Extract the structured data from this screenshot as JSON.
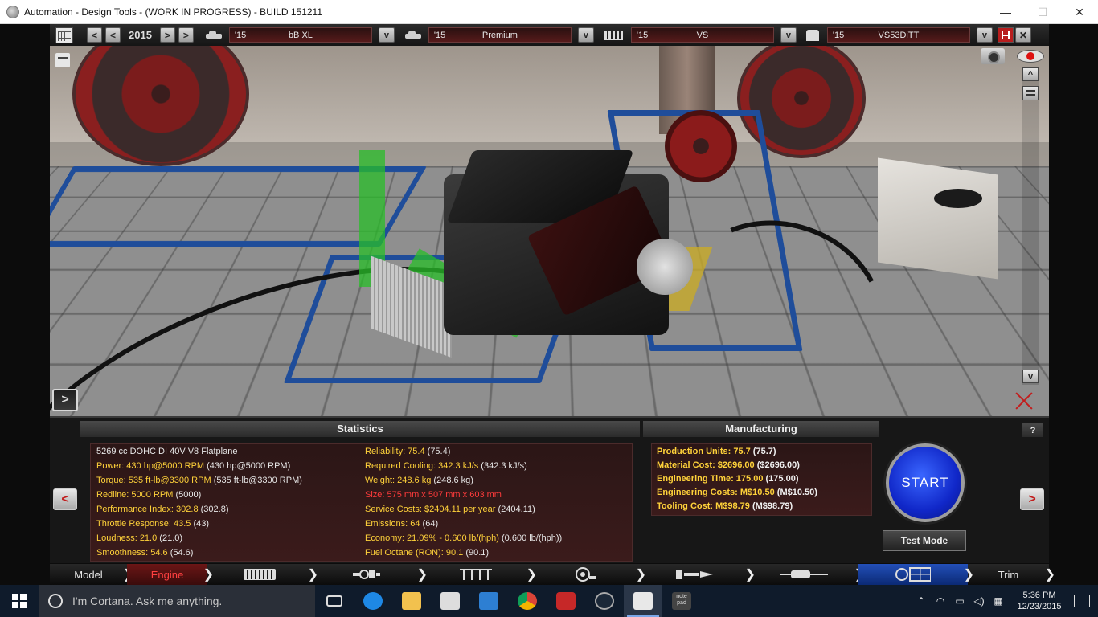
{
  "window": {
    "title": "Automation - Design Tools - (WORK IN PROGRESS) - BUILD 151211",
    "minimize": "—",
    "maximize": "☐",
    "close": "✕"
  },
  "toolbar": {
    "year": "2015",
    "prev2": "<",
    "prev1": "<",
    "next1": ">",
    "next2": ">",
    "model": {
      "year": "'15",
      "name": "bB XL"
    },
    "trim": {
      "year": "'15",
      "name": "Premium"
    },
    "engine": {
      "year": "'15",
      "name": "VS"
    },
    "variant": {
      "year": "'15",
      "name": "VS53DiTT"
    },
    "dropdown": "v",
    "close": "✕"
  },
  "viewport": {
    "expand_label": ">",
    "scroll_up": "^",
    "scroll_down": "v"
  },
  "statistics": {
    "title": "Statistics",
    "left": [
      {
        "label": "5269 cc DOHC DI 40V V8 Flatplane",
        "value": "",
        "style": "plain"
      },
      {
        "label": "Power: 430 hp@5000 RPM",
        "value": " (430 hp@5000 RPM)",
        "style": "yellow"
      },
      {
        "label": "Torque: 535 ft-lb@3300 RPM",
        "value": " (535 ft-lb@3300 RPM)",
        "style": "yellow"
      },
      {
        "label": "Redline: 5000 RPM",
        "value": " (5000)",
        "style": "yellow"
      },
      {
        "label": "Performance Index: 302.8",
        "value": " (302.8)",
        "style": "yellow"
      },
      {
        "label": "Throttle Response: 43.5",
        "value": " (43)",
        "style": "yellow"
      },
      {
        "label": "Loudness: 21.0",
        "value": " (21.0)",
        "style": "yellow"
      },
      {
        "label": "Smoothness: 54.6",
        "value": " (54.6)",
        "style": "yellow"
      }
    ],
    "right": [
      {
        "label": "Reliability: 75.4",
        "value": " (75.4)",
        "style": "yellow"
      },
      {
        "label": "Required Cooling: 342.3 kJ/s",
        "value": " (342.3 kJ/s)",
        "style": "yellow"
      },
      {
        "label": "Weight: 248.6 kg",
        "value": " (248.6 kg)",
        "style": "yellow"
      },
      {
        "label": "Size: 575 mm x 507 mm x 603 mm",
        "value": "",
        "style": "red"
      },
      {
        "label": "Service Costs: $2404.11 per year",
        "value": " (2404.11)",
        "style": "yellow"
      },
      {
        "label": "Emissions: 64",
        "value": " (64)",
        "style": "yellow"
      },
      {
        "label": "Economy: 21.09% - 0.600 lb/(hph)",
        "value": " (0.600 lb/(hph))",
        "style": "yellow"
      },
      {
        "label": "Fuel Octane (RON): 90.1",
        "value": " (90.1)",
        "style": "yellow"
      }
    ]
  },
  "manufacturing": {
    "title": "Manufacturing",
    "rows": [
      {
        "label": "Production Units: 75.7",
        "value": " (75.7)"
      },
      {
        "label": "Material Cost: $2696.00",
        "value": " ($2696.00)"
      },
      {
        "label": "Engineering Time: 175.00",
        "value": " (175.00)"
      },
      {
        "label": "Engineering Costs: M$10.50",
        "value": " (M$10.50)"
      },
      {
        "label": "Tooling Cost: M$98.79",
        "value": " (M$98.79)"
      }
    ]
  },
  "controls": {
    "help": "?",
    "prev": "<",
    "next": ">",
    "start": "START",
    "test_mode": "Test Mode"
  },
  "tabs": {
    "model": "Model",
    "engine": "Engine",
    "trim": "Trim"
  },
  "taskbar": {
    "cortana_placeholder": "I'm Cortana. Ask me anything.",
    "time": "5:36 PM",
    "date": "12/23/2015",
    "notepad_label": "note pad"
  },
  "colors": {
    "accent_yellow": "#ffd23a",
    "accent_red": "#ff3b3b",
    "start_blue": "#1027c8",
    "panel_bg": "#2b1616"
  }
}
